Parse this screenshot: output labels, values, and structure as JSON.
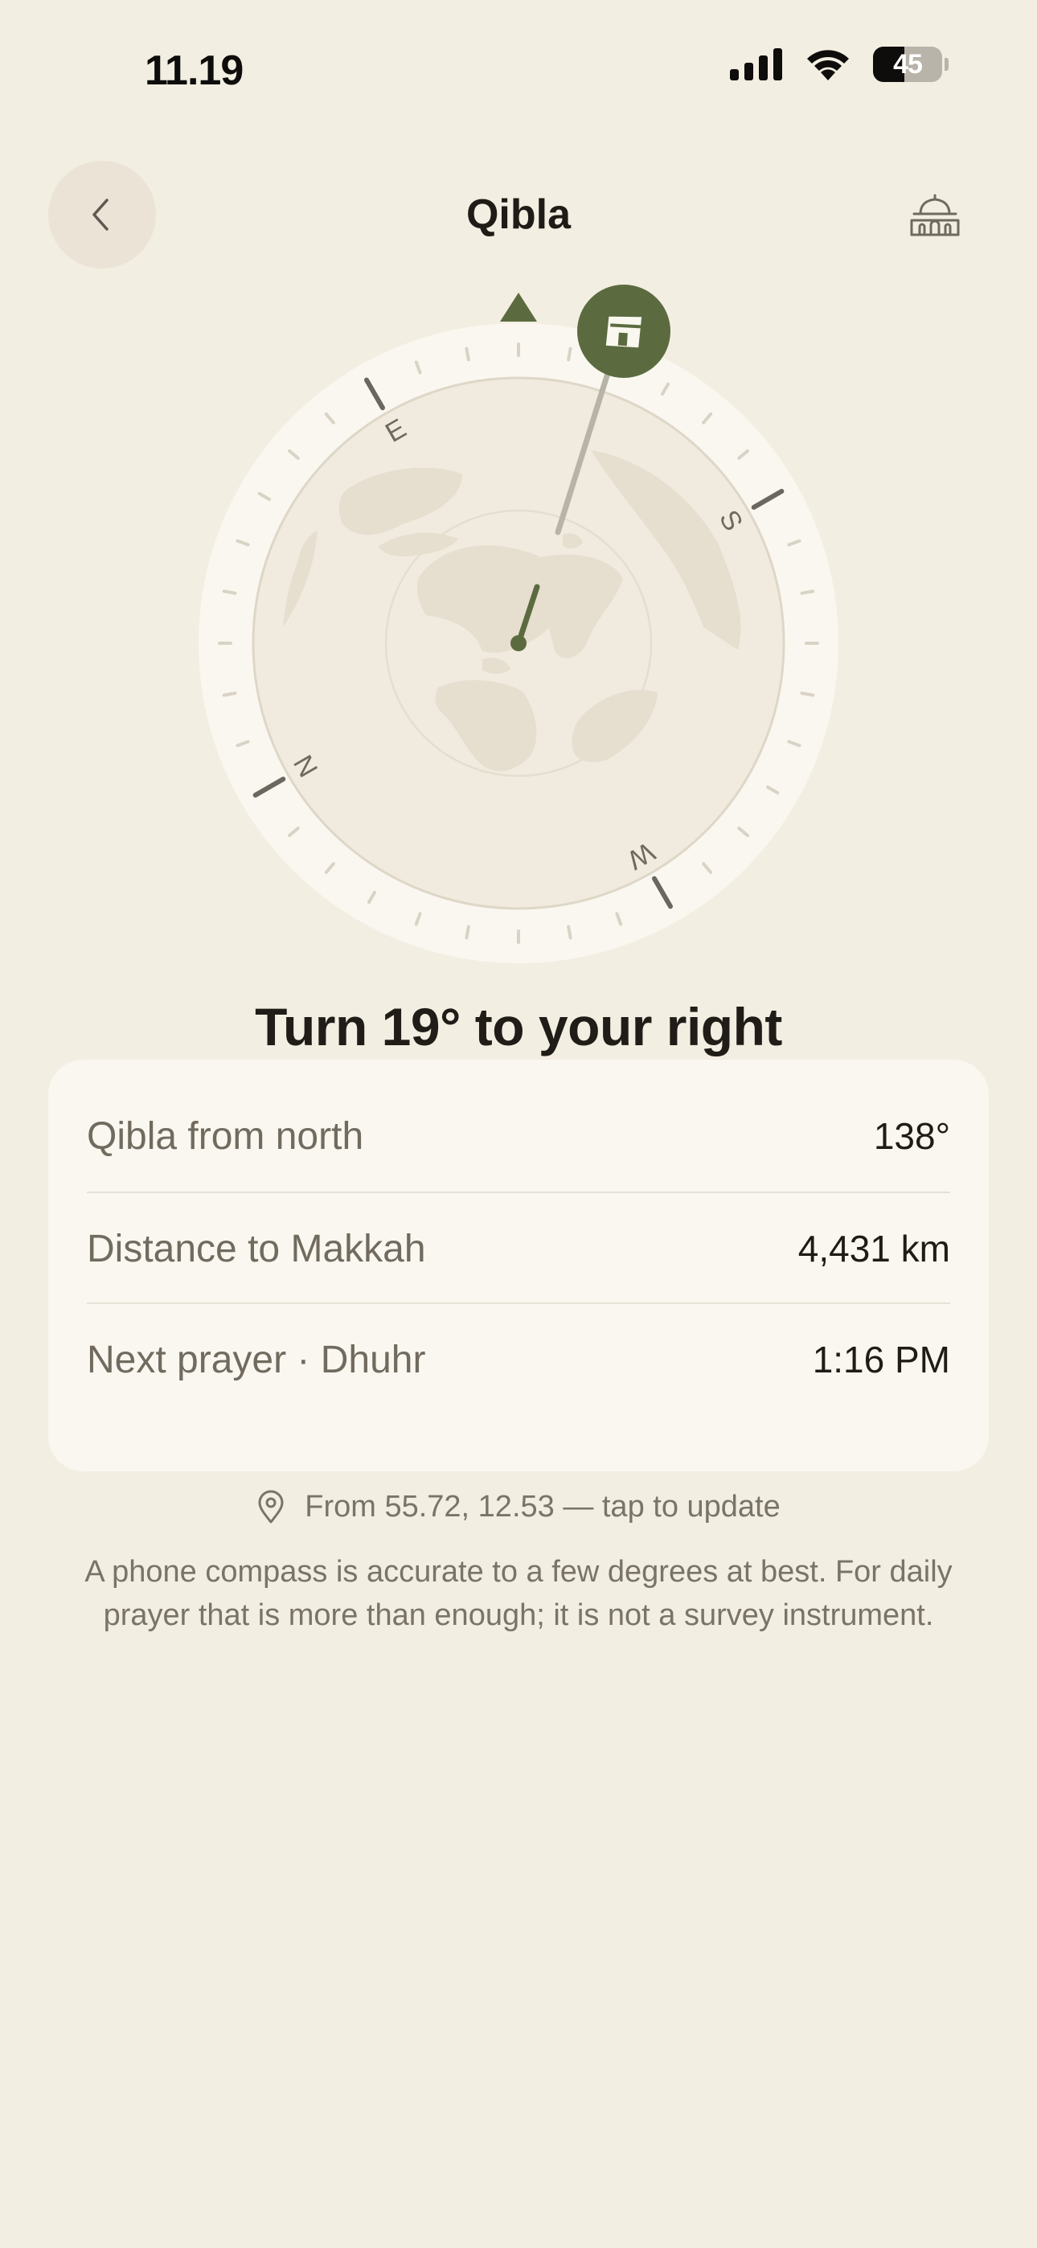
{
  "status_bar": {
    "time": "11.19",
    "battery_level": "45",
    "icons": [
      "cellular-signal-icon",
      "wifi-icon",
      "battery-icon"
    ]
  },
  "header": {
    "title": "Qibla",
    "back_icon": "chevron-left-icon",
    "right_icon": "mosque-icon"
  },
  "compass": {
    "cardinals": {
      "north": "N",
      "east": "E",
      "south": "S",
      "west": "W"
    },
    "heading_marker_icon": "triangle-up-icon",
    "kaaba_icon": "kaaba-icon",
    "qibla_bearing_deg": 138,
    "turn_deg": 19
  },
  "instruction": "Turn 19° to your right",
  "info": {
    "rows": [
      {
        "label": "Qibla from north",
        "value": "138°"
      },
      {
        "label": "Distance to Makkah",
        "value": "4,431 km"
      },
      {
        "label": "Next prayer · Dhuhr",
        "value": "1:16 PM"
      }
    ]
  },
  "location": {
    "icon": "location-pin-icon",
    "text": "From 55.72, 12.53 — tap to update"
  },
  "disclaimer": "A phone compass is accurate to a few degrees at best. For daily prayer that is more than enough; it is not a survey instrument.",
  "colors": {
    "background": "#F3EEE2",
    "card": "#FAF7F0",
    "accent": "#5B6B3F",
    "text_primary": "#1F1C17",
    "text_secondary": "#716B5F"
  }
}
